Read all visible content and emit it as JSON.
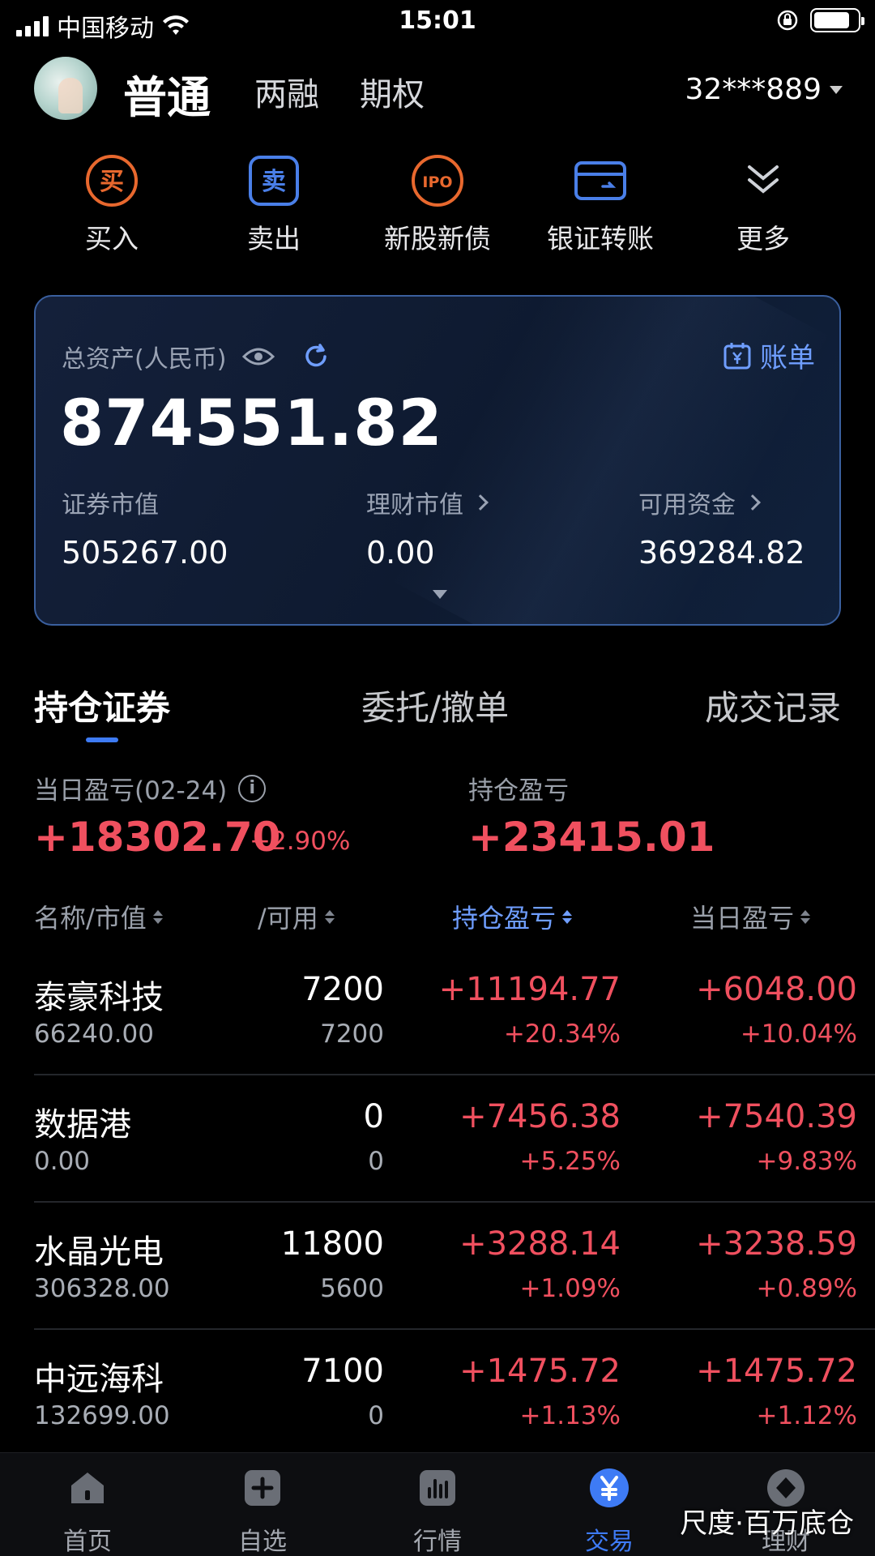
{
  "status_bar": {
    "carrier": "中国移动",
    "time": "15:01"
  },
  "header": {
    "account_tabs": [
      "普通",
      "两融",
      "期权"
    ],
    "account_no": "32***889"
  },
  "actions": [
    {
      "label": "买入",
      "icon": "buy-icon",
      "glyph": "买",
      "color": "#e8682e"
    },
    {
      "label": "卖出",
      "icon": "sell-icon",
      "glyph": "卖",
      "color": "#4a7fe8"
    },
    {
      "label": "新股新债",
      "icon": "ipo-icon",
      "glyph": "IPO",
      "color": "#e8682e"
    },
    {
      "label": "银证转账",
      "icon": "bank-card-icon",
      "glyph": "",
      "color": "#4a7fe8"
    },
    {
      "label": "更多",
      "icon": "chevron-double-down-icon",
      "glyph": "",
      "color": "#cfd2d8"
    }
  ],
  "assets": {
    "total_label": "总资产(人民币)",
    "total_value": "874551.82",
    "bill_label": "账单",
    "securities_label": "证券市值",
    "securities_value": "505267.00",
    "wealth_label": "理财市值",
    "wealth_value": "0.00",
    "cash_label": "可用资金",
    "cash_value": "369284.82"
  },
  "tabs": [
    "持仓证券",
    "委托/撤单",
    "成交记录"
  ],
  "pnl": {
    "day_label": "当日盈亏(02-24)",
    "day_value": "+18302.70",
    "day_pct": "+2.90%",
    "position_label": "持仓盈亏",
    "position_value": "+23415.01"
  },
  "table": {
    "headers": [
      "名称/市值",
      "/可用",
      "持仓盈亏",
      "当日盈亏"
    ],
    "rows": [
      {
        "name": "泰豪科技",
        "market_value": "66240.00",
        "qty": "7200",
        "available": "7200",
        "position_pnl": "+11194.77",
        "position_pct": "+20.34%",
        "day_pnl": "+6048.00",
        "day_pct": "+10.04%"
      },
      {
        "name": "数据港",
        "market_value": "0.00",
        "qty": "0",
        "available": "0",
        "position_pnl": "+7456.38",
        "position_pct": "+5.25%",
        "day_pnl": "+7540.39",
        "day_pct": "+9.83%"
      },
      {
        "name": "水晶光电",
        "market_value": "306328.00",
        "qty": "11800",
        "available": "5600",
        "position_pnl": "+3288.14",
        "position_pct": "+1.09%",
        "day_pnl": "+3238.59",
        "day_pct": "+0.89%"
      },
      {
        "name": "中远海科",
        "market_value": "132699.00",
        "qty": "7100",
        "available": "0",
        "position_pnl": "+1475.72",
        "position_pct": "+1.13%",
        "day_pnl": "+1475.72",
        "day_pct": "+1.12%"
      }
    ]
  },
  "bottom_nav": [
    {
      "label": "首页",
      "icon": "home-icon"
    },
    {
      "label": "自选",
      "icon": "watchlist-add-icon"
    },
    {
      "label": "行情",
      "icon": "market-chart-icon"
    },
    {
      "label": "交易",
      "icon": "trade-yen-icon",
      "active": true
    },
    {
      "label": "理财",
      "icon": "wealth-icon"
    }
  ],
  "watermark": "尺度·百万底仓",
  "colors": {
    "accent": "#3e7bf5",
    "gain": "#f0505f",
    "buy": "#e8682e"
  }
}
